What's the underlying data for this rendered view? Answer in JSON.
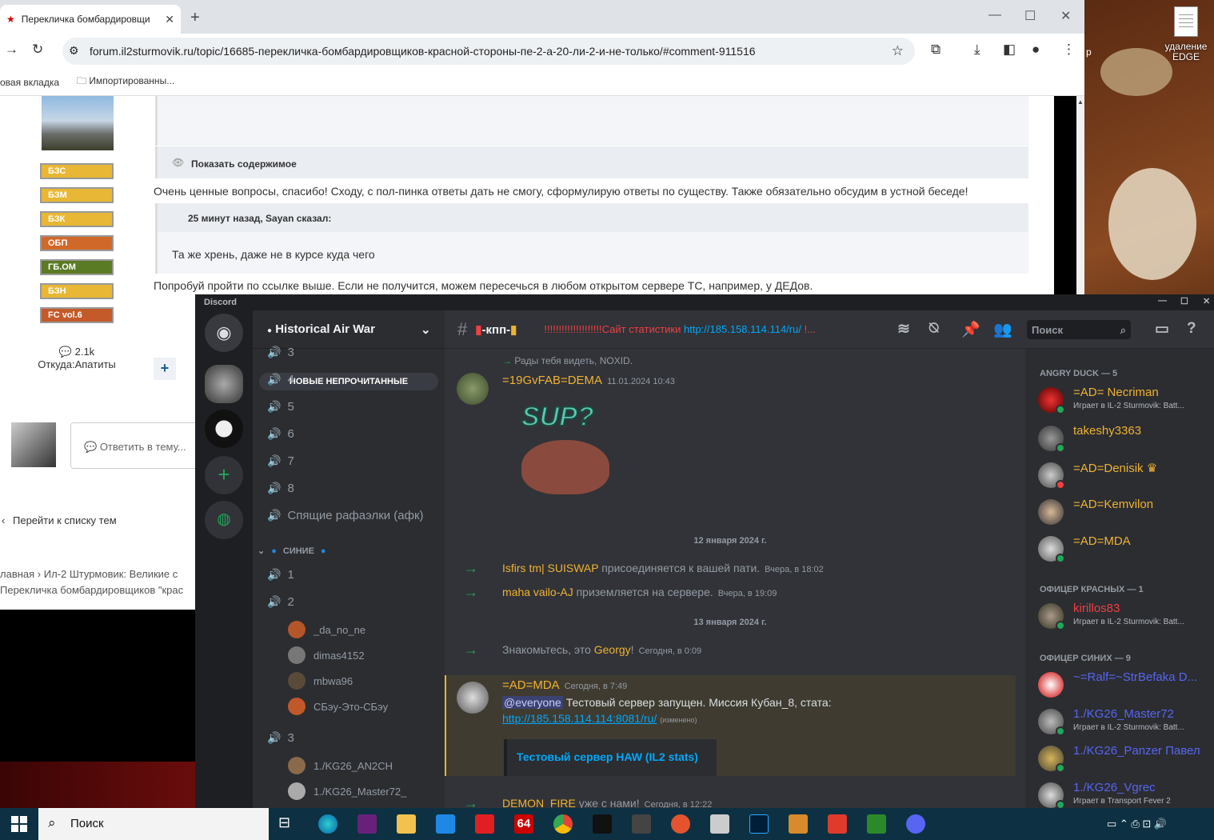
{
  "browser": {
    "tab_title": "Перекличка бомбардировщи",
    "url": "forum.il2sturmovik.ru/topic/16685-перекличка-бомбардировщиков-красной-стороны-пе-2-а-20-ли-2-и-не-только/#comment-911516",
    "bookmarks": [
      "овая вкладка",
      "Импортированны..."
    ]
  },
  "forum": {
    "badges": [
      "БЗС",
      "БЗМ",
      "БЗК",
      "ОБП",
      "ГБ.ОМ",
      "БЗН",
      "FC vol.6"
    ],
    "spoiler_label": "Показать содержимое",
    "post_text_1": "Очень ценные вопросы, спасибо! Сходу, с пол-пинка ответы дать не смогу, сформулирую ответы по существу. Также обязательно обсудим в устной беседе!",
    "quote_header": "25 минут назад, Sayan сказал:",
    "quote_body": "Та же хрень, даже не в курсе куда чего",
    "post_text_2": "Попробуй пройти по ссылке выше. Если не получится, можем пересечься в любом открытом сервере ТС, например, у ДЕДов.",
    "reputation": "2.1k",
    "location": "Откуда:Апатиты",
    "reply_placeholder": "Ответить в тему...",
    "go_to_list": "Перейти к списку тем",
    "breadcrumb_1": "лавная  ›  Ил-2 Штурмовик: Великие с",
    "breadcrumb_2": "Перекличка бомбардировщиков \"крас"
  },
  "discord": {
    "app_title": "Discord",
    "server_name": "Historical Air War",
    "unread_label": "НОВЫЕ НЕПРОЧИТАННЫЕ",
    "voice_channels_top": [
      "3",
      "4",
      "5",
      "6",
      "7",
      "8",
      "Спящие рафаэлки (афк)"
    ],
    "category": "СИНИЕ",
    "voice_channels_blue": [
      "1",
      "2"
    ],
    "channel2_users": [
      "_da_no_ne",
      "dimas4152",
      "mbwa96",
      "СБэу-Это-СБэу"
    ],
    "voice_channel_3": "3",
    "channel3_users": [
      "1./KG26_AN2CH",
      "1./KG26_Master72_"
    ],
    "channel_name": "-кпп-",
    "topic_prefix": "!!!!!!!!!!!!!!!!!!!!Сайт статистики",
    "topic_link": "http://185.158.114.114/ru/",
    "topic_suffix": "!...",
    "search_placeholder": "Поиск",
    "messages": {
      "reply_preview": "Рады тебя видеть, NOXID.",
      "m1_user": "=19GvFAB=DEMA",
      "m1_time": "11.01.2024 10:43",
      "sticker_text": "SUP?",
      "date_1": "12 января 2024 г.",
      "s1_user": "Isfirs tm| SUISWAP",
      "s1_text": "присоединяется к вашей пати.",
      "s1_time": "Вчера, в 18:02",
      "s2_user": "maha vailo-AJ",
      "s2_text": "приземляется на сервере.",
      "s2_time": "Вчера, в 19:09",
      "date_2": "13 января 2024 г.",
      "s3_pre": "Знакомьтесь, это",
      "s3_user": "Georgy",
      "s3_post": "!",
      "s3_time": "Сегодня, в 0:09",
      "m2_user": "=AD=MDA",
      "m2_time": "Сегодня, в 7:49",
      "m2_mention": "@everyone",
      "m2_text": "Тестовый сервер запущен. Миссия Кубан_8, стата:",
      "m2_link": "http://185.158.114.114:8081/ru/",
      "m2_edited": "(изменено)",
      "m2_embed": "Тестовый сервер HAW (IL2 stats)",
      "s4_user": "DEMON_FIRE",
      "s4_text": "уже с нами!",
      "s4_time": "Сегодня, в 12:22"
    },
    "members": {
      "group1": "ANGRY DUCK — 5",
      "g1": [
        {
          "name": "=AD= Necriman",
          "activity": "Играет в IL-2 Sturmovik: Batt..."
        },
        {
          "name": "takeshy3363",
          "activity": ""
        },
        {
          "name": "=AD=Denisik",
          "activity": ""
        },
        {
          "name": "=AD=Kemvilon",
          "activity": ""
        },
        {
          "name": "=AD=MDA",
          "activity": ""
        }
      ],
      "group2": "ОФИЦЕР КРАСНЫХ — 1",
      "g2": [
        {
          "name": "kirillos83",
          "activity": "Играет в IL-2 Sturmovik: Batt..."
        }
      ],
      "group3": "ОФИЦЕР СИНИХ — 9",
      "g3": [
        {
          "name": "~=Ralf=~StrBefaka D...",
          "activity": ""
        },
        {
          "name": "1./KG26_Master72",
          "activity": "Играет в IL-2 Sturmovik: Batt..."
        },
        {
          "name": "1./KG26_Panzer Павел",
          "activity": ""
        },
        {
          "name": "1./KG26_Vgrec",
          "activity": "Играет в Transport Fever 2"
        }
      ]
    }
  },
  "desktop": {
    "icon_label": "удаление EDGE",
    "peek": "р"
  },
  "taskbar": {
    "search": "Поиск",
    "badge": "64"
  }
}
